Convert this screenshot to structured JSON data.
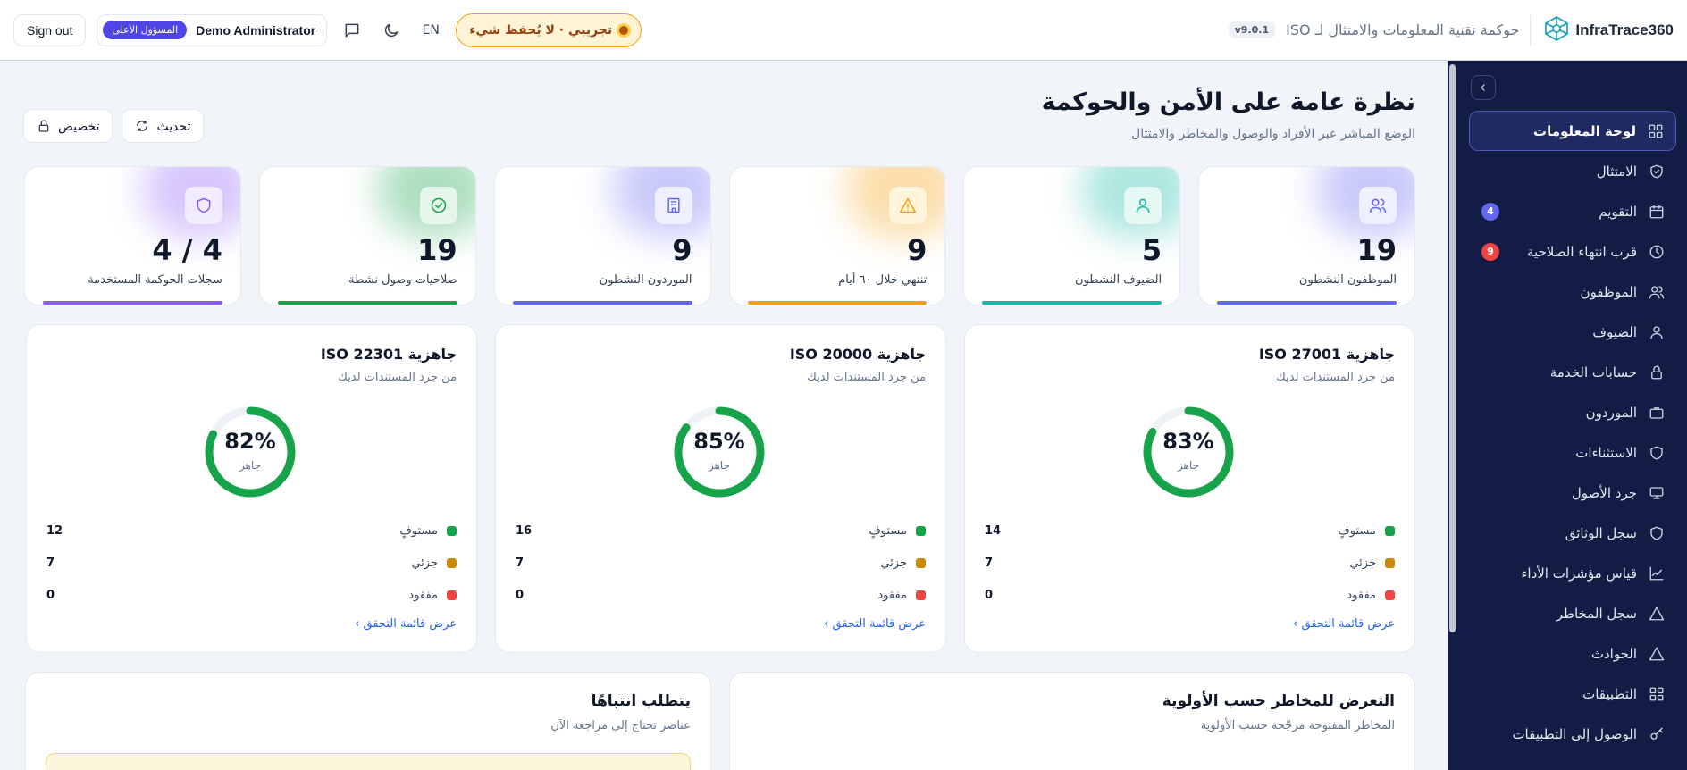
{
  "header": {
    "sign_out": "Sign out",
    "role_badge": "المسؤول الأعلى",
    "user_name": "Demo Administrator",
    "lang": "EN",
    "demo_label": "تجريبي · لا يُحفظ شيء",
    "version": "v9.0.1",
    "app_subtitle": "حوكمة تقنية المعلومات والامتثال لـ ISO",
    "brand_name": "InfraTrace360"
  },
  "sidebar": {
    "items": [
      {
        "label": "لوحة المعلومات",
        "icon": "dashboard-icon",
        "active": true
      },
      {
        "label": "الامتثال",
        "icon": "shield-check-icon"
      },
      {
        "label": "التقويم",
        "icon": "calendar-icon",
        "badge": "4"
      },
      {
        "label": "قرب انتهاء الصلاحية",
        "icon": "clock-icon",
        "badge": "9"
      },
      {
        "label": "الموظفون",
        "icon": "users-icon"
      },
      {
        "label": "الضيوف",
        "icon": "user-icon"
      },
      {
        "label": "حسابات الخدمة",
        "icon": "lock-icon"
      },
      {
        "label": "الموردون",
        "icon": "briefcase-icon"
      },
      {
        "label": "الاستثناءات",
        "icon": "shield-icon"
      },
      {
        "label": "جرد الأصول",
        "icon": "monitor-icon"
      },
      {
        "label": "سجل الوثائق",
        "icon": "shield-doc-icon"
      },
      {
        "label": "قياس مؤشرات الأداء",
        "icon": "chart-line-icon"
      },
      {
        "label": "سجل المخاطر",
        "icon": "alert-triangle-icon"
      },
      {
        "label": "الحوادث",
        "icon": "warning-icon"
      },
      {
        "label": "التطبيقات",
        "icon": "grid-icon"
      },
      {
        "label": "الوصول إلى التطبيقات",
        "icon": "key-icon"
      }
    ]
  },
  "main": {
    "title": "نظرة عامة على الأمن والحوكمة",
    "subtitle": "الوضع المباشر عبر الأفراد والوصول والمخاطر والامتثال",
    "refresh_label": "تحديث",
    "customize_label": "تخصيص",
    "stats": [
      {
        "value": "19",
        "label": "الموظفون النشطون",
        "icon": "users-icon",
        "color": "#6366f1",
        "tint": "#eef0ff"
      },
      {
        "value": "5",
        "label": "الضيوف النشطون",
        "icon": "user-icon",
        "color": "#14b8a6",
        "tint": "#e6f8f4"
      },
      {
        "value": "9",
        "label": "تنتهي خلال ٦٠ أيام",
        "icon": "alert-icon",
        "color": "#f59e0b",
        "tint": "#fff4dc"
      },
      {
        "value": "9",
        "label": "الموردون النشطون",
        "icon": "building-icon",
        "color": "#6366f1",
        "tint": "#eef0ff"
      },
      {
        "value": "19",
        "label": "صلاحيات وصول نشطة",
        "icon": "check-circle-icon",
        "color": "#16a34a",
        "tint": "#e6f6ea"
      },
      {
        "value": "4 / 4",
        "label": "سجلات الحوكمة المستخدمة",
        "icon": "shield-icon",
        "color": "#8b5cf6",
        "tint": "#f1ecff"
      }
    ],
    "readiness": [
      {
        "title": "جاهزية ISO 27001",
        "subtitle": "من جرد المستندات لديك",
        "pct": 83,
        "pct_text": "83%",
        "ready_label": "جاهز",
        "met": "14",
        "partial": "7",
        "missing": "0",
        "link": "عرض قائمة التحقق ›"
      },
      {
        "title": "جاهزية ISO 20000",
        "subtitle": "من جرد المستندات لديك",
        "pct": 85,
        "pct_text": "85%",
        "ready_label": "جاهز",
        "met": "16",
        "partial": "7",
        "missing": "0",
        "link": "عرض قائمة التحقق ›"
      },
      {
        "title": "جاهزية ISO 22301",
        "subtitle": "من جرد المستندات لديك",
        "pct": 82,
        "pct_text": "82%",
        "ready_label": "جاهز",
        "met": "12",
        "partial": "7",
        "missing": "0",
        "link": "عرض قائمة التحقق ›"
      }
    ],
    "legend_labels": {
      "met": "مستوفٍ",
      "partial": "جزئي",
      "missing": "مفقود"
    },
    "legend_colors": {
      "met": "#16a34a",
      "partial": "#ca8a04",
      "missing": "#ef4444"
    },
    "risk_card": {
      "title": "التعرض للمخاطر حسب الأولوية",
      "subtitle": "المخاطر المفتوحة مرجّحة حسب الأولوية"
    },
    "attention_card": {
      "title": "يتطلب انتباهًا",
      "subtitle": "عناصر تحتاج إلى مراجعة الآن"
    }
  }
}
